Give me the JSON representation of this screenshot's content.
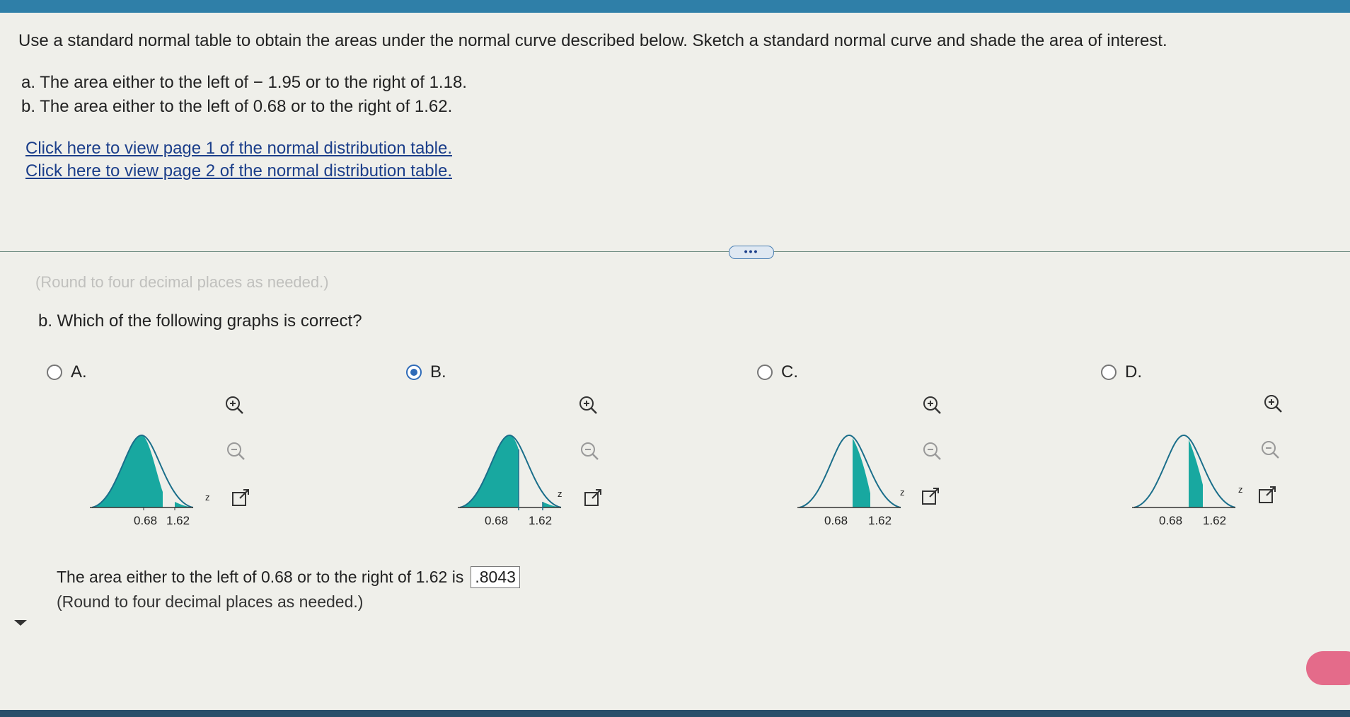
{
  "question": {
    "main": "Use a standard normal table to obtain the areas under the normal curve described below. Sketch a standard normal curve and shade the area of interest.",
    "part_a": "a. The area either to the left of − 1.95 or to the right of 1.18.",
    "part_b": "b. The area either to the left of 0.68 or to the right of 1.62."
  },
  "links": {
    "page1": "Click here to view page 1 of the normal distribution table.",
    "page2": "Click here to view page 2 of the normal distribution table."
  },
  "expand_button": "•••",
  "faint_text": "(Round to four decimal places as needed.)",
  "part_b_question": "b. Which of the following graphs is correct?",
  "options": [
    {
      "letter": "A.",
      "selected": false,
      "left_label": "0.68",
      "right_label": "1.62",
      "axis_label": "z"
    },
    {
      "letter": "B.",
      "selected": true,
      "left_label": "0.68",
      "right_label": "1.62",
      "axis_label": "z"
    },
    {
      "letter": "C.",
      "selected": false,
      "left_label": "0.68",
      "right_label": "1.62",
      "axis_label": "z"
    },
    {
      "letter": "D.",
      "selected": false,
      "left_label": "0.68",
      "right_label": "1.62",
      "axis_label": "z"
    }
  ],
  "result": {
    "text": "The area either to the left of 0.68 or to the right of 1.62 is",
    "answer": ".8043",
    "note": "(Round to four decimal places as needed.)"
  },
  "colors": {
    "shade": "#18a8a0",
    "link": "#1b3e8a",
    "radio_selected": "#2f6bb8",
    "top_bar": "#2f7fa8"
  }
}
